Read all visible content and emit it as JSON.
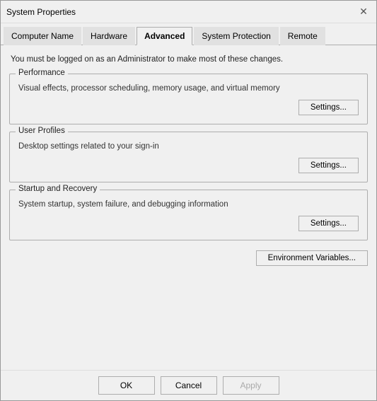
{
  "window": {
    "title": "System Properties"
  },
  "tabs": [
    {
      "label": "Computer Name",
      "active": false
    },
    {
      "label": "Hardware",
      "active": false
    },
    {
      "label": "Advanced",
      "active": true
    },
    {
      "label": "System Protection",
      "active": false
    },
    {
      "label": "Remote",
      "active": false
    }
  ],
  "admin_notice": "You must be logged on as an Administrator to make most of these changes.",
  "groups": [
    {
      "legend": "Performance",
      "description": "Visual effects, processor scheduling, memory usage, and virtual memory",
      "button": "Settings..."
    },
    {
      "legend": "User Profiles",
      "description": "Desktop settings related to your sign-in",
      "button": "Settings..."
    },
    {
      "legend": "Startup and Recovery",
      "description": "System startup, system failure, and debugging information",
      "button": "Settings..."
    }
  ],
  "env_button": "Environment Variables...",
  "bottom_buttons": {
    "ok": "OK",
    "cancel": "Cancel",
    "apply": "Apply"
  }
}
